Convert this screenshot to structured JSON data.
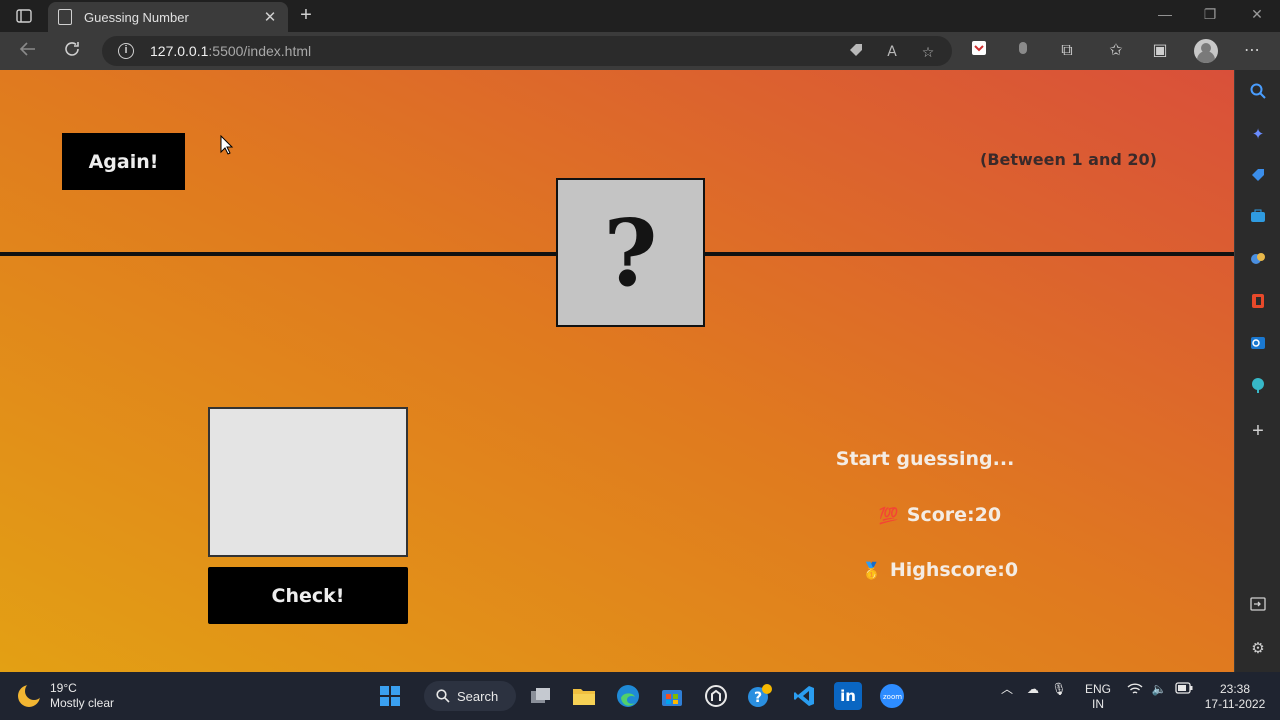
{
  "browser": {
    "tab_title": "Guessing Number",
    "tab_close": "✕",
    "new_tab": "+",
    "url_host": "127.0.0.1",
    "url_rest": ":5500/index.html",
    "window_controls": [
      "—",
      "❐",
      "✕"
    ]
  },
  "game": {
    "again_label": "Again!",
    "range_hint": "(Between 1 and 20)",
    "secret_number": "?",
    "check_label": "Check!",
    "message": "Start guessing...",
    "score_label": "Score:",
    "score_value": "20",
    "score_emoji": "💯",
    "highscore_label": "Highscore:",
    "highscore_value": "0",
    "highscore_emoji": "🥇",
    "colors": {
      "gradient_start": "#e3a014",
      "gradient_mid": "#e07a1f",
      "gradient_end": "#d9503a",
      "button_bg": "#000000",
      "number_box_bg": "#c4c4c4"
    }
  },
  "taskbar": {
    "weather_temp": "19°C",
    "weather_desc": "Mostly clear",
    "search_label": "Search",
    "lang_top": "ENG",
    "lang_bottom": "IN",
    "time": "23:38",
    "date": "17-11-2022"
  }
}
